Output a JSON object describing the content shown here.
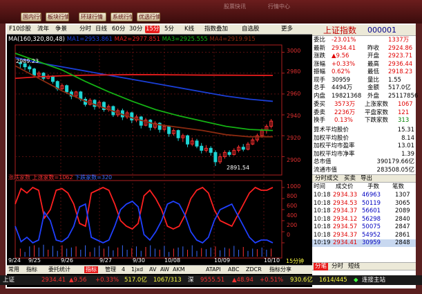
{
  "top_nav": {
    "buttons": [
      "国内行情",
      "板块行情",
      "环球行情",
      "系统行情",
      "优选行情"
    ],
    "faded": [
      "股票快讯",
      "行情中心"
    ]
  },
  "toolbar": {
    "items": [
      "F10",
      "诊股",
      "流年",
      "争景",
      "分时",
      "日线",
      "60分",
      "30分",
      "15分",
      "5分",
      "K线",
      "指数叠加",
      "自选股",
      "更多"
    ],
    "selected_index": 8
  },
  "ma_legend": {
    "label": "MA",
    "params": "(160,320,80,48)",
    "ma1": "MA1=2953.861",
    "ma2": "MA2=2977.851",
    "ma3": "MA3=2925.555",
    "ma4": "MA4=2919.915"
  },
  "colors": {
    "ma1": "#1a3fd6",
    "ma2": "#e81c1c",
    "ma3": "#14b214",
    "ma4": "#8b2a10",
    "up": "#ff3030",
    "down": "#1fd4d4"
  },
  "chart_labels": {
    "high_label": "2989.23",
    "low_label": "2891.54",
    "price_ticks": [
      "3000",
      "2980",
      "2960",
      "2940",
      "2920",
      "2900"
    ],
    "ind_ticks": [
      "1000",
      "800",
      "600",
      "400",
      "200",
      "0"
    ],
    "date_ticks": [
      "9/24",
      "9/25",
      "9/26",
      "9/27",
      "9/30",
      "10/08",
      "10/09",
      "10/10"
    ],
    "indicator_legend_prefix": "涨跌家数",
    "indicator_up": "上涨家数=1062",
    "indicator_down": "下跌家数=320",
    "timeframe": "15分钟"
  },
  "chart_data": {
    "type": "candlestick",
    "ylim": [
      2885,
      3003
    ],
    "ma_series": [
      {
        "name": "MA1",
        "values": [
          2995,
          2990,
          2986,
          2982,
          2978,
          2974,
          2970,
          2966,
          2962,
          2958,
          2955,
          2953
        ]
      },
      {
        "name": "MA2",
        "values": [
          2975,
          2976.5,
          2977.5,
          2978,
          2978.3,
          2978.5,
          2978.5,
          2978.3,
          2978.1,
          2978,
          2977.9,
          2977.8
        ]
      },
      {
        "name": "MA3",
        "values": [
          2999,
          2991,
          2983,
          2972,
          2962,
          2953,
          2945,
          2939,
          2934,
          2929,
          2926,
          2925
        ]
      },
      {
        "name": "MA4",
        "values": [
          2987,
          2975,
          2963,
          2953,
          2945,
          2937,
          2931,
          2928,
          2925,
          2921,
          2919,
          2919
        ]
      }
    ],
    "candles": [
      [
        2990,
        2989,
        2992,
        2985
      ],
      [
        2989,
        2986,
        2990,
        2983
      ],
      [
        2986,
        2984,
        2988,
        2981
      ],
      [
        2984,
        2978,
        2985,
        2976
      ],
      [
        2978,
        2980,
        2982,
        2976
      ],
      [
        2980,
        2975,
        2981,
        2973
      ],
      [
        2975,
        2977,
        2979,
        2974
      ],
      [
        2977,
        2972,
        2978,
        2970
      ],
      [
        2972,
        2965,
        2973,
        2963
      ],
      [
        2965,
        2968,
        2970,
        2964
      ],
      [
        2968,
        2962,
        2969,
        2960
      ],
      [
        2962,
        2958,
        2964,
        2955
      ],
      [
        2958,
        2962,
        2963,
        2956
      ],
      [
        2962,
        2955,
        2963,
        2953
      ],
      [
        2955,
        2950,
        2957,
        2948
      ],
      [
        2950,
        2954,
        2956,
        2949
      ],
      [
        2954,
        2948,
        2955,
        2945
      ],
      [
        2948,
        2952,
        2954,
        2946
      ],
      [
        2952,
        2945,
        2953,
        2943
      ],
      [
        2945,
        2948,
        2950,
        2943
      ],
      [
        2948,
        2940,
        2949,
        2938
      ],
      [
        2940,
        2944,
        2946,
        2938
      ],
      [
        2944,
        2938,
        2946,
        2935
      ],
      [
        2938,
        2942,
        2944,
        2936
      ],
      [
        2942,
        2935,
        2943,
        2932
      ],
      [
        2935,
        2938,
        2940,
        2933
      ],
      [
        2938,
        2930,
        2939,
        2927
      ],
      [
        2930,
        2935,
        2937,
        2929
      ],
      [
        2935,
        2928,
        2936,
        2925
      ],
      [
        2928,
        2932,
        2934,
        2926
      ],
      [
        2932,
        2926,
        2933,
        2923
      ],
      [
        2926,
        2929,
        2931,
        2924
      ],
      [
        2929,
        2922,
        2930,
        2919
      ],
      [
        2922,
        2925,
        2927,
        2920
      ],
      [
        2925,
        2918,
        2926,
        2915
      ],
      [
        2918,
        2920,
        2922,
        2914
      ],
      [
        2920,
        2912,
        2921,
        2909
      ],
      [
        2912,
        2915,
        2918,
        2910
      ],
      [
        2915,
        2910,
        2917,
        2908
      ],
      [
        2910,
        2906,
        2913,
        2903
      ],
      [
        2906,
        2908,
        2911,
        2904
      ],
      [
        2908,
        2904,
        2910,
        2901
      ],
      [
        2904,
        2895,
        2906,
        2891
      ],
      [
        2895,
        2900,
        2903,
        2893
      ],
      [
        2900,
        2904,
        2906,
        2898
      ],
      [
        2904,
        2902,
        2906,
        2900
      ],
      [
        2902,
        2906,
        2908,
        2901
      ],
      [
        2906,
        2909,
        2911,
        2904
      ],
      [
        2909,
        2907,
        2912,
        2905
      ],
      [
        2907,
        2912,
        2914,
        2906
      ],
      [
        2912,
        2916,
        2918,
        2911
      ],
      [
        2916,
        2920,
        2922,
        2914
      ],
      [
        2920,
        2925,
        2927,
        2918
      ],
      [
        2925,
        2929,
        2931,
        2922
      ],
      [
        2929,
        2934,
        2936,
        2927
      ]
    ],
    "breadth_up": [
      700,
      980,
      900,
      1000,
      950,
      450,
      600,
      950,
      980,
      900,
      700,
      350,
      300,
      900,
      950,
      1000,
      950,
      700,
      400,
      300,
      250,
      350,
      850,
      950,
      800,
      600,
      300,
      250,
      300,
      500,
      800,
      950,
      1000,
      900,
      600,
      400,
      350,
      300,
      500,
      700,
      900,
      1000,
      950,
      950,
      1000
    ],
    "breadth_down": [
      300,
      20,
      100,
      0,
      50,
      550,
      400,
      50,
      20,
      100,
      300,
      650,
      700,
      100,
      50,
      0,
      50,
      300,
      600,
      700,
      750,
      650,
      150,
      50,
      200,
      400,
      700,
      750,
      700,
      500,
      200,
      50,
      0,
      100,
      400,
      600,
      650,
      700,
      500,
      300,
      100,
      0,
      50,
      50,
      0
    ],
    "volume": [
      0.6,
      0.3,
      0.8,
      0.9,
      0.7,
      0.95,
      0.5,
      0.85,
      0.4,
      0.9,
      0.6,
      0.7,
      0.8,
      0.5,
      0.9,
      0.3,
      0.7,
      0.85,
      0.6,
      0.8,
      0.45,
      0.7,
      0.9,
      0.5,
      0.65,
      0.8,
      0.4,
      0.75,
      0.9,
      0.6,
      0.5,
      0.85,
      0.3,
      0.6,
      0.7,
      0.8,
      0.5,
      0.9,
      0.4,
      0.65,
      0.55,
      0.7,
      0.8,
      0.45,
      0.7,
      0.6,
      0.85,
      0.5,
      0.75,
      0.4,
      0.6,
      0.55,
      0.7,
      0.5,
      0.6
    ]
  },
  "panel": {
    "title": "上证指数",
    "code": "000001",
    "rows": [
      {
        "l1": "委比",
        "v1": "-23.01%",
        "l2": "",
        "v2": "1337万"
      },
      {
        "l1": "最新",
        "v1": "2934.41",
        "l2": "昨收",
        "v2": "2924.86"
      },
      {
        "l1": "涨跌",
        "v1": "▲9.56",
        "l2": "开盘",
        "v2": "2923.71"
      },
      {
        "l1": "涨幅",
        "v1": "+0.33%",
        "l2": "最高",
        "v2": "2936.44"
      },
      {
        "l1": "振幅",
        "v1": "0.62%",
        "l2": "最低",
        "v2": "2918.23"
      },
      {
        "l1": "现手",
        "v1": "30959",
        "l2": "量比",
        "v2": "1.55"
      },
      {
        "l1": "总手",
        "v1": "4494万",
        "l2": "金额",
        "v2": "517.0亿"
      },
      {
        "l1": "内盘",
        "v1": "19821368",
        "l2": "外盘",
        "v2": "25117856"
      }
    ],
    "rows2": [
      {
        "l1": "委买",
        "v1": "3573万",
        "l2": "上涨家数",
        "v2": "1067"
      },
      {
        "l1": "委卖",
        "v1": "2236万",
        "l2": "平盘家数",
        "v2": "121"
      },
      {
        "l1": "换手",
        "v1": "0.13%",
        "l2": "下跌家数",
        "v2": "313"
      }
    ],
    "rows3": [
      {
        "l": "算术平均股价",
        "v": "15.31"
      },
      {
        "l": "加权平均股价",
        "v": "8.14"
      },
      {
        "l": "加权平均市盈率",
        "v": "13.01"
      },
      {
        "l": "加权平均市净率",
        "v": "1.39"
      },
      {
        "l": "总市值",
        "v": "390179.66亿"
      },
      {
        "l": "流通市值",
        "v": "283508.05亿"
      }
    ],
    "trade_tabs": [
      "分时成交",
      "买卖",
      "导出"
    ],
    "trade_header": [
      "时间",
      "成交价",
      "手数",
      "笔数"
    ],
    "trades": [
      [
        "10:18",
        "2934.33",
        "46963",
        "1307"
      ],
      [
        "10:18",
        "2934.53",
        "50119",
        "3065"
      ],
      [
        "10:18",
        "2934.37",
        "56601",
        "2089"
      ],
      [
        "10:18",
        "2934.12",
        "56298",
        "2840"
      ],
      [
        "10:18",
        "2934.57",
        "50075",
        "2847"
      ],
      [
        "10:18",
        "2934.37",
        "54952",
        "2861"
      ],
      [
        "10:19",
        "2934.41",
        "30959",
        "2848"
      ]
    ],
    "bottom_tabs": [
      "分笔",
      "分时",
      "短线"
    ]
  },
  "bottom_bar": [
    "常用",
    "指标",
    "委托统计",
    "指标",
    "管理",
    "4",
    "1jxd",
    "AV",
    "AW",
    "AKM",
    "ATAPI",
    "ABC",
    "ZDCR",
    "指标分享"
  ],
  "status": {
    "index_name": "上证",
    "sh_price": "2934.41",
    "sh_change": "▲9.56",
    "sh_pct": "+0.33%",
    "sh_amt": "517.0亿",
    "sh_breadth": "1067/313",
    "sz_name": "深",
    "sz_price": "9555.51",
    "sz_change": "▲48.94",
    "sz_pct": "+0.51%",
    "sz_amt": "930.6亿",
    "sz_breadth": "1614/445",
    "conn": "连接主站"
  }
}
